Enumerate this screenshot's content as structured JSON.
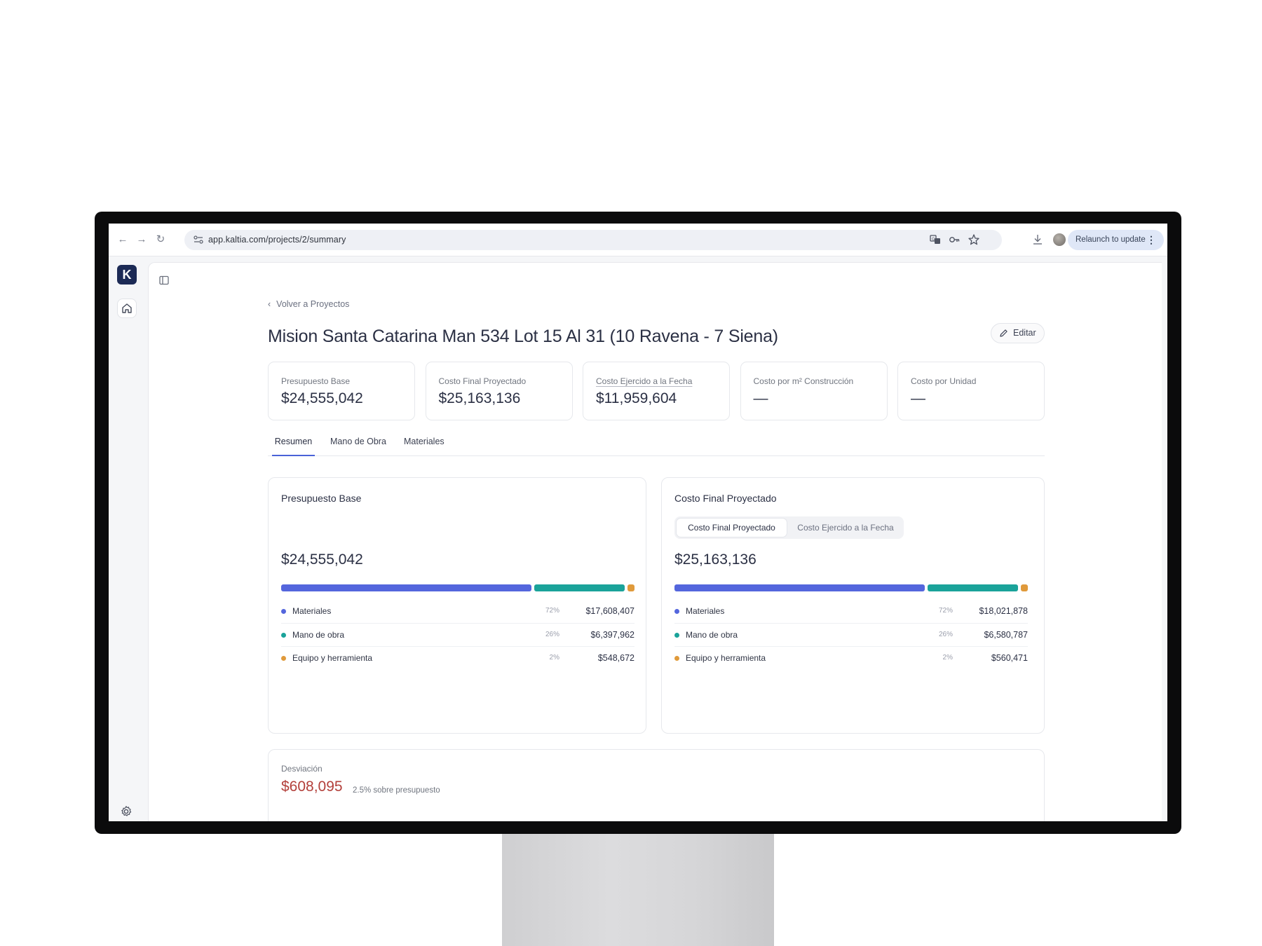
{
  "browser": {
    "url": "app.kaltia.com/projects/2/summary",
    "relaunch_label": "Relaunch to update"
  },
  "sidebar": {
    "logo_letter": "K"
  },
  "page": {
    "back_label": "Volver a Proyectos",
    "title": "Mision Santa Catarina Man 534 Lot 15 Al 31 (10 Ravena - 7 Siena)",
    "edit_label": "Editar"
  },
  "kpis": [
    {
      "label": "Presupuesto Base",
      "value": "$24,555,042"
    },
    {
      "label": "Costo Final Proyectado",
      "value": "$25,163,136"
    },
    {
      "label": "Costo Ejercido a la Fecha",
      "value": "$11,959,604"
    },
    {
      "label": "Costo por m² Construcción",
      "value": "—"
    },
    {
      "label": "Costo por Unidad",
      "value": "—"
    }
  ],
  "tabs": [
    {
      "label": "Resumen",
      "active": true
    },
    {
      "label": "Mano de Obra",
      "active": false
    },
    {
      "label": "Materiales",
      "active": false
    }
  ],
  "colors": {
    "materiales": "#5466dd",
    "mano_de_obra": "#1aa39a",
    "equipo": "#e09a3b",
    "deviation": "#b3403b"
  },
  "base_card": {
    "title": "Presupuesto Base",
    "total": "$24,555,042",
    "breakdown": [
      {
        "name": "Materiales",
        "pct": "72%",
        "share": 0.72,
        "value": "$17,608,407"
      },
      {
        "name": "Mano de obra",
        "pct": "26%",
        "share": 0.26,
        "value": "$6,397,962"
      },
      {
        "name": "Equipo y herramienta",
        "pct": "2%",
        "share": 0.02,
        "value": "$548,672"
      }
    ]
  },
  "final_card": {
    "title": "Costo Final Proyectado",
    "toggle": {
      "on": "Costo Final Proyectado",
      "off": "Costo Ejercido a la Fecha"
    },
    "total": "$25,163,136",
    "breakdown": [
      {
        "name": "Materiales",
        "pct": "72%",
        "share": 0.72,
        "value": "$18,021,878"
      },
      {
        "name": "Mano de obra",
        "pct": "26%",
        "share": 0.26,
        "value": "$6,580,787"
      },
      {
        "name": "Equipo y herramienta",
        "pct": "2%",
        "share": 0.02,
        "value": "$560,471"
      }
    ]
  },
  "deviation": {
    "label": "Desviación",
    "value": "$608,095",
    "note": "2.5% sobre presupuesto"
  }
}
